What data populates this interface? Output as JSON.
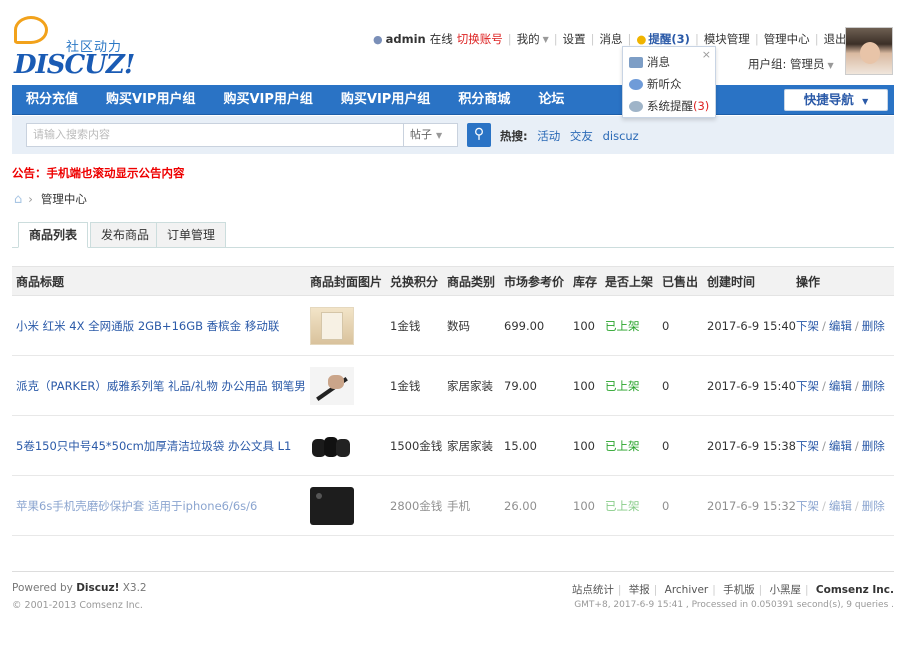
{
  "logo": {
    "sub": "社区动力",
    "main": "DISCUZ!"
  },
  "topnav": {
    "user": "admin",
    "status": "在线",
    "switch": "切换账号",
    "mine": "我的",
    "settings": "设置",
    "messages": "消息",
    "reminders": "提醒(3)",
    "module_manage": "模块管理",
    "manage_center": "管理中心",
    "logout": "退出",
    "user_group": "用户组: 管理员"
  },
  "popup": {
    "close": "×",
    "items": [
      {
        "label": "消息",
        "count": ""
      },
      {
        "label": "新听众",
        "count": ""
      },
      {
        "label": "系统提醒",
        "count": "(3)"
      }
    ]
  },
  "nav": {
    "items": [
      "积分充值",
      "购买VIP用户组",
      "购买VIP用户组",
      "购买VIP用户组",
      "积分商城",
      "论坛"
    ],
    "quick": "快捷导航"
  },
  "search": {
    "placeholder": "请输入搜索内容",
    "type": "帖子",
    "hot_label": "热搜:",
    "hot_items": [
      "活动",
      "交友",
      "discuz"
    ]
  },
  "notice": "公告：手机端也滚动显示公告内容",
  "breadcrumb": {
    "current": "管理中心"
  },
  "tabs": [
    "商品列表",
    "发布商品",
    "订单管理"
  ],
  "table": {
    "headers": [
      "商品标题",
      "商品封面图片",
      "兑换积分",
      "商品类别",
      "市场参考价",
      "库存",
      "是否上架",
      "已售出",
      "创建时间",
      "操作"
    ],
    "rows": [
      {
        "title": "小米 红米 4X 全网通版 2GB+16GB 香槟金 移动联",
        "points": "1金钱",
        "category": "数码",
        "price": "699.00",
        "stock": "100",
        "status": "已上架",
        "sold": "0",
        "created": "2017-6-9 15:40"
      },
      {
        "title": "派克（PARKER）威雅系列笔 礼品/礼物 办公用品 钢笔男",
        "points": "1金钱",
        "category": "家居家装",
        "price": "79.00",
        "stock": "100",
        "status": "已上架",
        "sold": "0",
        "created": "2017-6-9 15:40"
      },
      {
        "title": "5卷150只中号45*50cm加厚清洁垃圾袋 办公文具 L1",
        "points": "1500金钱",
        "category": "家居家装",
        "price": "15.00",
        "stock": "100",
        "status": "已上架",
        "sold": "0",
        "created": "2017-6-9 15:38"
      },
      {
        "title": "苹果6s手机壳磨砂保护套 适用于iphone6/6s/6",
        "points": "2800金钱",
        "category": "手机",
        "price": "26.00",
        "stock": "100",
        "status": "已上架",
        "sold": "0",
        "created": "2017-6-9 15:32"
      }
    ],
    "ops": [
      "下架",
      "编辑",
      "删除"
    ]
  },
  "footer": {
    "powered_prefix": "Powered by",
    "powered_name": "Discuz!",
    "version": "X3.2",
    "copyright": "© 2001-2013 Comsenz Inc.",
    "links": [
      "站点统计",
      "举报",
      "Archiver",
      "手机版",
      "小黑屋"
    ],
    "company": "Comsenz Inc.",
    "process": "GMT+8, 2017-6-9 15:41 , Processed in 0.050391 second(s), 9 queries ."
  }
}
